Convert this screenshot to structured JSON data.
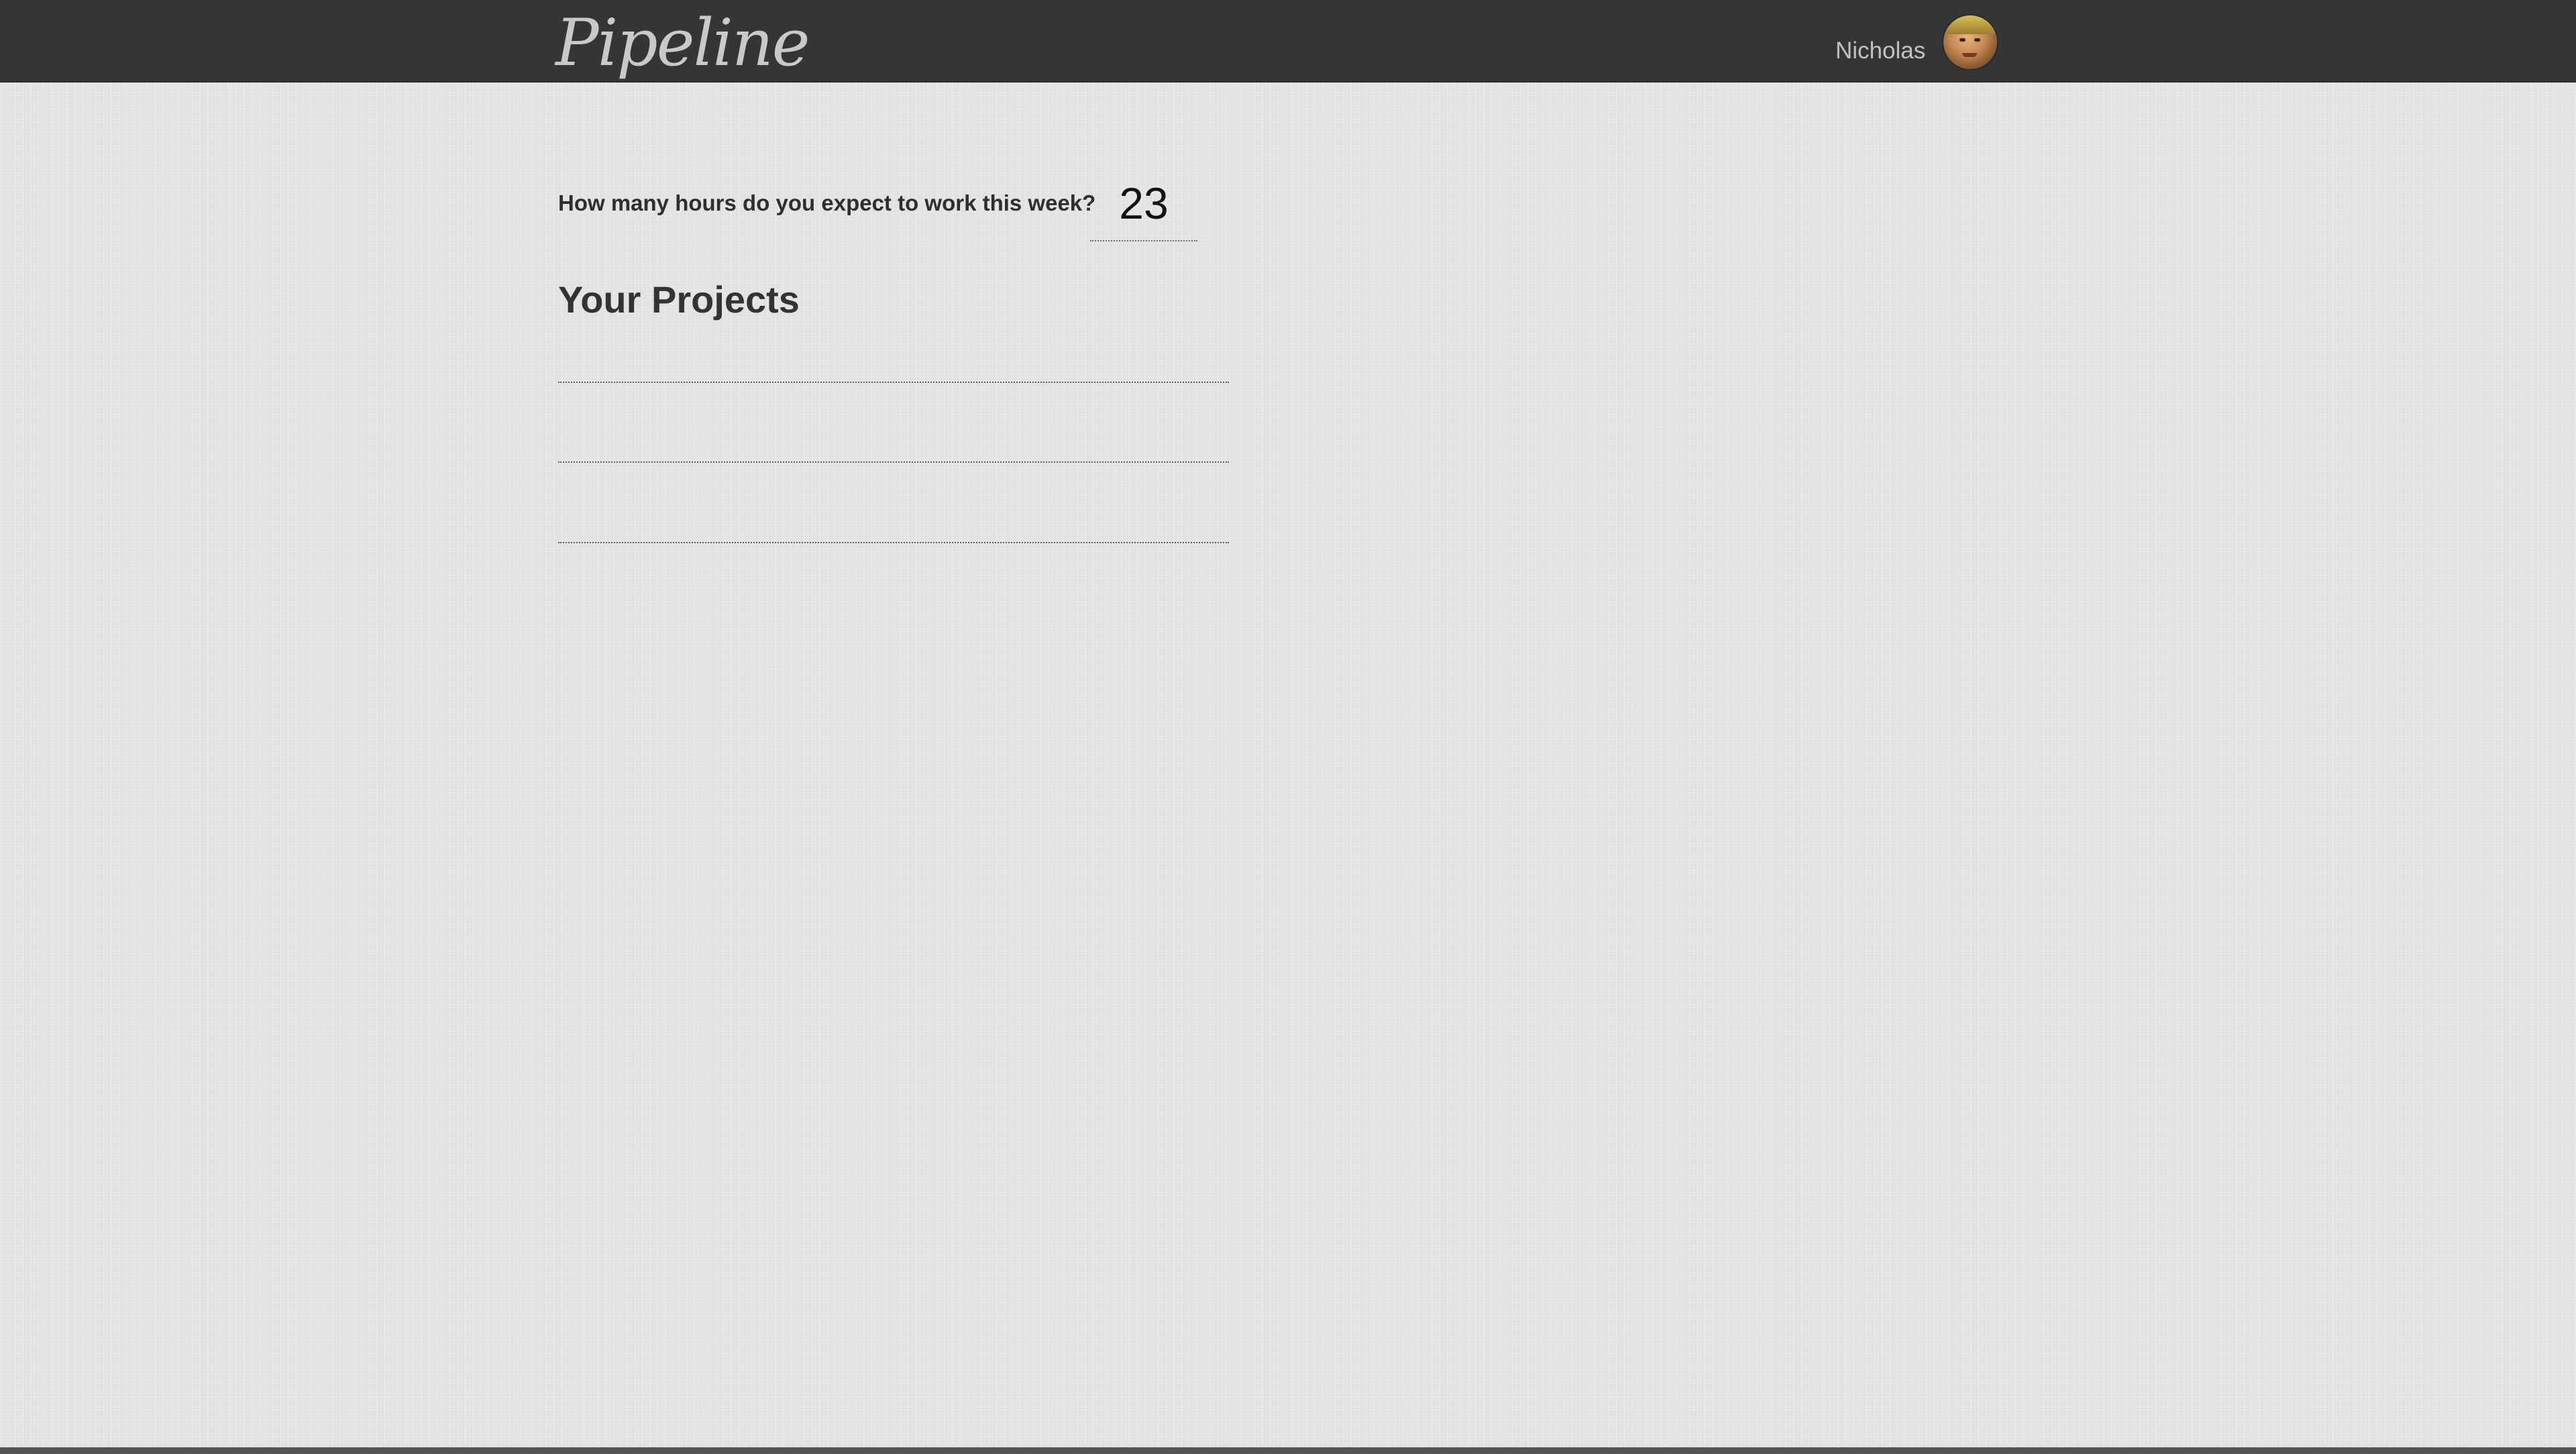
{
  "header": {
    "logo_text": "Pipeline",
    "user_name": "Nicholas"
  },
  "main": {
    "hours_question": "How many hours do you expect to work this week?",
    "hours_value": "23",
    "projects_title": "Your Projects",
    "project_rows": [
      "",
      "",
      ""
    ]
  }
}
